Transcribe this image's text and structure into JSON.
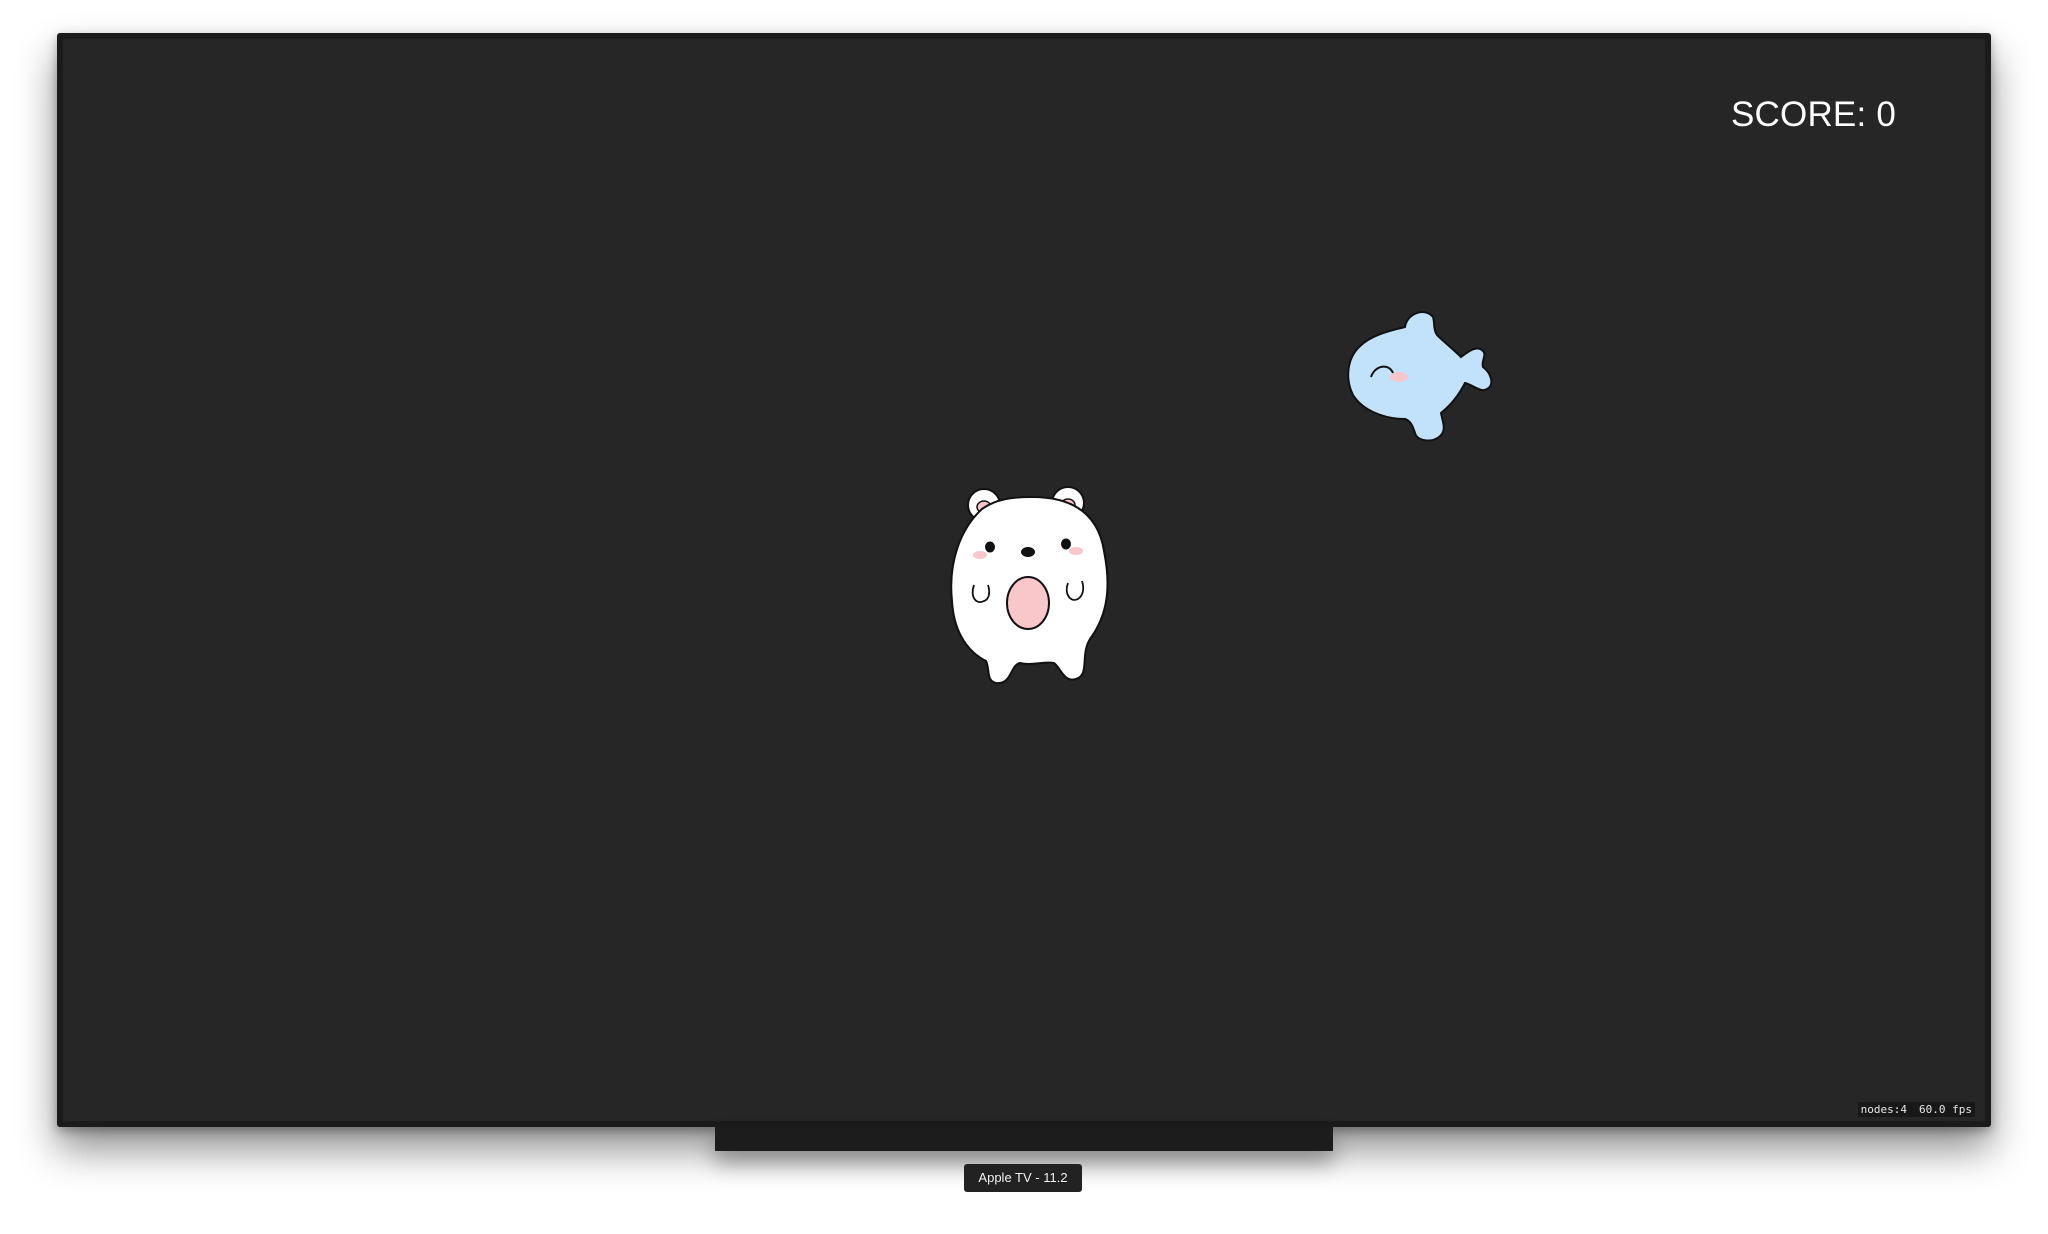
{
  "game": {
    "score_text": "SCORE: 0",
    "stats": {
      "nodes": "nodes:4",
      "fps": "60.0 fps"
    },
    "sprites": [
      "polar-bear",
      "blue-fish"
    ]
  },
  "simulator": {
    "device_label": "Apple TV - 11.2"
  },
  "colors": {
    "screen_background": "#262626",
    "bezel": "#1b1b1b",
    "fish_body": "#c2e1fb",
    "bear_mouth": "#f9c6c9"
  }
}
